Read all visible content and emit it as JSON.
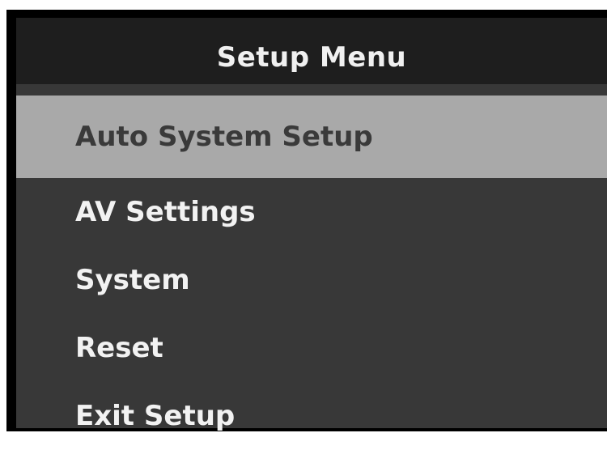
{
  "header": {
    "title": "Setup Menu"
  },
  "menu": {
    "selected_index": 0,
    "items": [
      {
        "label": "Auto System Setup"
      },
      {
        "label": "AV Settings"
      },
      {
        "label": "System"
      },
      {
        "label": "Reset"
      },
      {
        "label": "Exit Setup"
      }
    ]
  },
  "colors": {
    "background": "#383838",
    "header": "#1e1e1e",
    "highlight": "#a9a9a9",
    "text": "#f2f2f2",
    "selected_text": "#3a3a3a"
  }
}
